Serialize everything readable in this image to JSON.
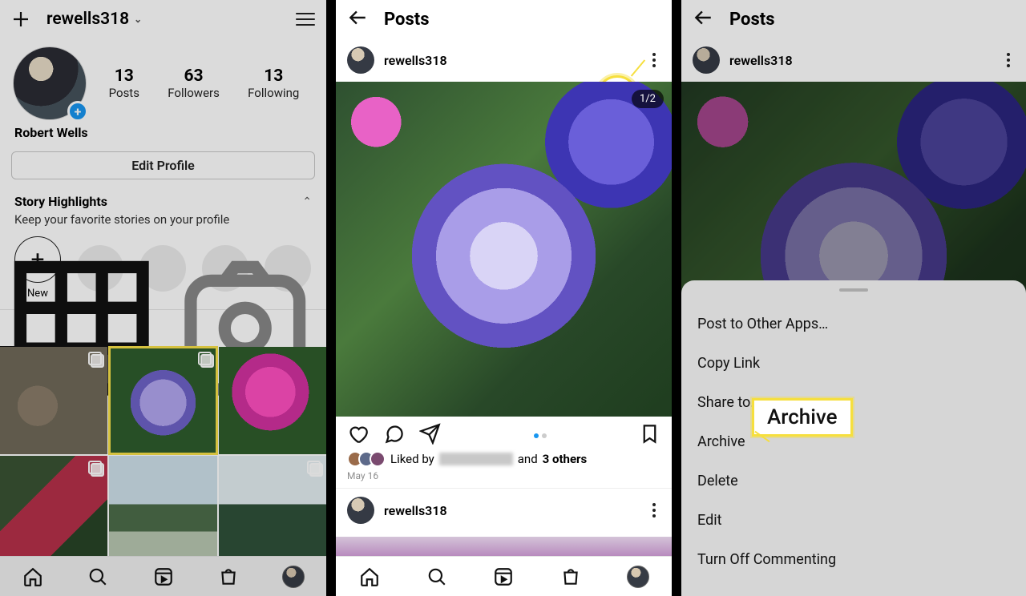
{
  "screen1": {
    "username": "rewells318",
    "fullname": "Robert Wells",
    "stats": {
      "posts_num": "13",
      "posts_lbl": "Posts",
      "followers_num": "63",
      "followers_lbl": "Followers",
      "following_num": "13",
      "following_lbl": "Following"
    },
    "edit_profile": "Edit Profile",
    "highlights_title": "Story Highlights",
    "highlights_sub": "Keep your favorite stories on your profile",
    "new_label": "New"
  },
  "screen2": {
    "title": "Posts",
    "username": "rewells318",
    "counter": "1/2",
    "liked_prefix": "Liked by",
    "liked_and": "and",
    "liked_others": "3 others",
    "date": "May 16",
    "username2": "rewells318"
  },
  "screen3": {
    "title": "Posts",
    "username": "rewells318",
    "menu": {
      "post_other": "Post to Other Apps…",
      "copy_link": "Copy Link",
      "share_to": "Share to…",
      "archive": "Archive",
      "delete": "Delete",
      "edit": "Edit",
      "turn_off": "Turn Off Commenting"
    },
    "callout": "Archive"
  }
}
